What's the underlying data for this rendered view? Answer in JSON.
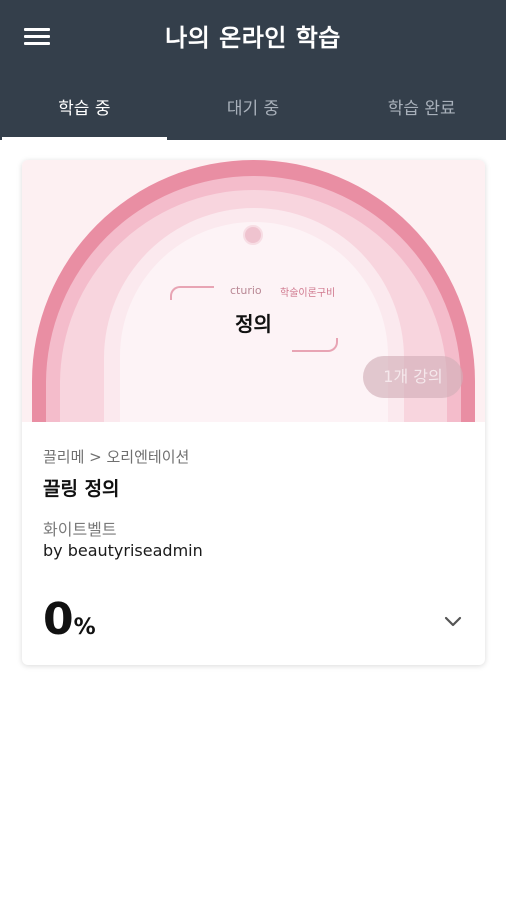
{
  "header": {
    "title": "나의 온라인 학습",
    "menu_icon": "hamburger-menu-icon",
    "background": "#343f4b"
  },
  "tabs": [
    {
      "label": "학습 중",
      "active": true
    },
    {
      "label": "대기 중",
      "active": false
    },
    {
      "label": "학습 완료",
      "active": false
    }
  ],
  "course_card": {
    "thumbnail": {
      "brand": "cturio",
      "brand_sub": "학술이론구비",
      "title": "정의",
      "lecture_count": "1개 강의"
    },
    "category": "끌리메 > 오리엔테이션",
    "title": "끌링 정의",
    "belt": "화이트벨트",
    "author": "by beautyriseadmin",
    "progress_value": "0",
    "progress_unit": "%",
    "expand_icon": "chevron-down-icon"
  },
  "colors": {
    "accent_pink": "#e98ea3",
    "tab_active": "#ffffff",
    "tab_inactive": "#a8b0ba"
  }
}
